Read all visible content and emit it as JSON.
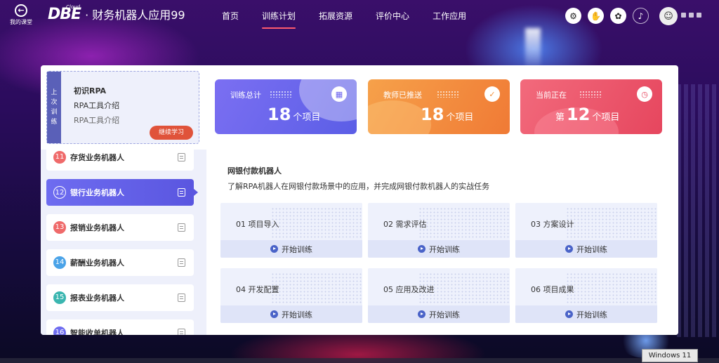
{
  "nav": {
    "back_label": "我的课堂",
    "logo_text": "DBE",
    "logo_cloud": "Cloud",
    "app_title": "· 财务机器人应用99",
    "menu": [
      {
        "label": "首页",
        "active": false
      },
      {
        "label": "训练计划",
        "active": true
      },
      {
        "label": "拓展资源",
        "active": false
      },
      {
        "label": "评价中心",
        "active": false
      },
      {
        "label": "工作应用",
        "active": false
      }
    ],
    "tools": [
      "robot-icon",
      "hand-icon",
      "paw-icon",
      "bell-icon"
    ]
  },
  "last_training": {
    "tag": [
      "上",
      "次",
      "训",
      "练"
    ],
    "title": "初识RPA",
    "subtitle": "RPA工具介绍",
    "subtitle2": "RPA工具介绍",
    "continue_label": "继续学习"
  },
  "stats": [
    {
      "label": "训练总计",
      "number": "18",
      "prefix": "",
      "unit": "个项目",
      "icon": "grid-icon",
      "color_from": "#7b6ff2",
      "color_to": "#5b5ee6"
    },
    {
      "label": "教师已推送",
      "number": "18",
      "prefix": "",
      "unit": "个项目",
      "icon": "check-icon",
      "color_from": "#f6a14a",
      "color_to": "#f07a35"
    },
    {
      "label": "当前正在",
      "number": "12",
      "prefix": "第",
      "unit": "个项目",
      "icon": "clock-icon",
      "color_from": "#f26a7c",
      "color_to": "#e6465e"
    }
  ],
  "robots": [
    {
      "num": "11",
      "label": "存货业务机器人",
      "color": "#ef6a6a",
      "active": false
    },
    {
      "num": "12",
      "label": "银行业务机器人",
      "color": "#6e6cf0",
      "active": true
    },
    {
      "num": "13",
      "label": "报销业务机器人",
      "color": "#ef6a6a",
      "active": false
    },
    {
      "num": "14",
      "label": "薪酬业务机器人",
      "color": "#4aa3e8",
      "active": false
    },
    {
      "num": "15",
      "label": "报表业务机器人",
      "color": "#3bb6b0",
      "active": false
    },
    {
      "num": "16",
      "label": "智能收单机器人",
      "color": "#6e6cf0",
      "active": false
    }
  ],
  "task": {
    "title": "网银付款机器人",
    "description": "了解RPA机器人在网银付款场景中的应用，并完成网银付款机器人的实战任务",
    "start_label": "开始训练",
    "steps": [
      "01 项目导入",
      "02 需求评估",
      "03 方案设计",
      "04 开发配置",
      "05 应用及改进",
      "06 项目成果"
    ]
  },
  "taskbar": {
    "badge": "Windows 11"
  }
}
